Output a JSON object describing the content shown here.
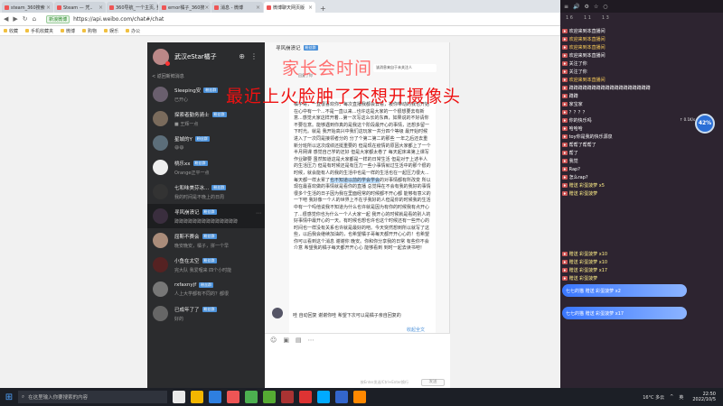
{
  "browser": {
    "tabs": [
      {
        "label": "steam_360搜索",
        "active": false
      },
      {
        "label": "Steam — 凭..",
        "active": false
      },
      {
        "label": "360导航_一个主页, 整个世界",
        "active": false
      },
      {
        "label": "ernor橘子_360搜",
        "active": false
      },
      {
        "label": "消息 - 微博",
        "active": false
      },
      {
        "label": "微博聊天网页版",
        "active": true
      }
    ],
    "new_tab": "+",
    "secure_label": "新浪微博",
    "url": "https://api.weibo.com/chat#/chat",
    "bookmarks": [
      "收藏",
      "手机收藏夹",
      "微博",
      "购物",
      "娱乐",
      "办公"
    ]
  },
  "sidebar": {
    "my_name": "武汉eStar橘子",
    "back_label": "< 返回新鲜消息",
    "conversations": [
      {
        "name": "Sleeping安",
        "badge": "粉丝群",
        "preview": "已开心",
        "color": "#6a5f6e",
        "active": false
      },
      {
        "name": "探索者勤务骑士",
        "badge": "粉丝群",
        "preview": "■ 王辉一点",
        "color": "#7a6b5c",
        "active": false
      },
      {
        "name": "星城的Y",
        "badge": "粉丝群",
        "preview": "😄😄",
        "color": "#5c6e7a",
        "active": false
      },
      {
        "name": "桃乐xx",
        "badge": "粉丝群",
        "preview": "Orange正平一点",
        "color": "#eee",
        "active": false
      },
      {
        "name": "七和味美芬冰...",
        "badge": "粉丝群",
        "preview": "我的时间是不晚上的日周",
        "color": "#333",
        "active": false
      },
      {
        "name": "寻风崩溃记",
        "badge": "粉丝群",
        "preview": "蹲蹲蹲蹲蹲蹲蹲蹲蹲蹲蹲蹲蹲蹲",
        "color": "#3a2e3e",
        "active": true
      },
      {
        "name": "屈斯不赛会",
        "badge": "粉丝群",
        "preview": "晚安晚安，橘子，拼一个早",
        "color": "#aa8c7a",
        "active": false
      },
      {
        "name": "小鱼在太空",
        "badge": "粉丝群",
        "preview": "完大队 我爱哩来 四个小时能",
        "color": "#552222",
        "active": false
      },
      {
        "name": "rxfaxnyjf",
        "badge": "粉丝群",
        "preview": "人上大学都有不同的？都很",
        "color": "#777",
        "active": false
      },
      {
        "name": "已成年了了",
        "badge": "粉丝群",
        "preview": "好的",
        "color": "#666",
        "active": false
      }
    ]
  },
  "chat": {
    "title": "寻风崩溃记",
    "badge": "粉丝群",
    "msg_top": "该消息来自于未关注人",
    "reply_tag": "回复了你",
    "long_msg_before": "橘子哥，一直很喜欢你，每次直播我都会去看，被你带动的我也开始在心中有一个...不是一直以来...也许这是大家的一个很想要去有新意...感觉大家这样开着...第一次写这么长的东西，如果说的不好请你不要在意。能够遇到你真的是我这个阶段最开心的事情，还想多留一下时光。就是 我开始高兴中我们这玩家一共分四个等级 最开始时候进入了一次同是接领者分的 分了个第二第二的那些 一年之后还去重新分班所以这次成绩还挺重要的 但是现在疫情的原因大家都上了一个半月网课 感觉自己学的还好 但是大家都太卷了 每天起床来第上课写作业聊要 虽然知道这是大家都是一样的日常生活 但是对于上述半人的生活压力 但是有时候还是有压力一些小事情就过生活中的那个很的时候，就会能有人的我的生活中也是一样的生活也在一起压力很大...每天都一样太累了",
    "long_msg_highlight": "也不知道以前的学会学会",
    "long_msg_after": "的对事情都有所改变 所以现在最喜欢做的事情就是看你的直播 总觉得在不会有我的我好的事情 很多个生活的日子因为我在里面经常的时候都不开心都 能够有意义的一下吧 我好像一个人的世界上不在乎我好的人但是你的时候我的生活中有一个吗他说我不知道为什么也许就是因为有你的时候我有点开心了...很感觉你也为什么一个人大家一起 我开心的时候就是看的别人的好事情中最开心的一天。有时候也想也许也这个时候还有一些开心的时间也一样没有关系也许就是最好的吧。今天突然想到所以就写了这些，以后我会继续加油的，也希望橘子哥每天都开开心心的！也希望你可以看到这个消息 谢谢你 晚安。你和你分享我的日常 有些你不会介意 希望我的橘子每天都开开心心 能够看到 到时一起去读书吧！",
    "read_tag": "收起全文",
    "auto_reply": "哇 自动回复 谢谢你哇 希望下次可以是橘子亲自回复的",
    "send_hint": "按Enter发送/Ctrl+Enter换行",
    "send_btn": "发送"
  },
  "overlay": {
    "line1": "家长会时间",
    "line2": "最近上火脸肿了不想开摄像头"
  },
  "right_panel": {
    "top_icons": [
      "≡",
      "🔊",
      "⚙",
      "☆",
      "○"
    ],
    "stats": [
      "1 6",
      "1 1",
      "1 3"
    ],
    "danmaku": [
      {
        "type": "chat",
        "user": "",
        "msg": "欢迎来到本直播间"
      },
      {
        "type": "join",
        "user": "",
        "msg": "欢迎来到本直播间"
      },
      {
        "type": "join",
        "user": "",
        "msg": "欢迎来到本直播间"
      },
      {
        "type": "chat",
        "user": "",
        "msg": "欢迎来到本直播间"
      },
      {
        "type": "chat",
        "user": "",
        "msg": "关注了你"
      },
      {
        "type": "chat",
        "user": "",
        "msg": "关注了你"
      },
      {
        "type": "join",
        "user": "",
        "msg": "欢迎来到本直播间"
      },
      {
        "type": "chat",
        "user": "",
        "msg": "蹲蹲蹲蹲蹲蹲蹲蹲蹲蹲蹲蹲蹲蹲蹲蹲蹲蹲"
      },
      {
        "type": "chat",
        "user": "",
        "msg": "蹲蹲"
      },
      {
        "type": "chat",
        "user": "",
        "msg": "家宝家"
      },
      {
        "type": "chat",
        "user": "",
        "msg": "？？？？"
      },
      {
        "type": "chat",
        "user": "",
        "msg": "你的快乐吗"
      },
      {
        "type": "chat",
        "user": "",
        "msg": "哈哈哈"
      },
      {
        "type": "chat",
        "user": "",
        "msg": "toy你是我的快乐源泉"
      },
      {
        "type": "chat",
        "user": "",
        "msg": "帮帮了帮帮了"
      },
      {
        "type": "chat",
        "user": "",
        "msg": "帮了"
      },
      {
        "type": "chat",
        "user": "",
        "msg": "我觉"
      },
      {
        "type": "chat",
        "user": "",
        "msg": "Rap?"
      },
      {
        "type": "chat",
        "user": "",
        "msg": "怎么rap?"
      },
      {
        "type": "gift",
        "user": "",
        "msg": "赠送 彩蛋菠萝 x5"
      },
      {
        "type": "gift",
        "user": "",
        "msg": "赠送 彩蛋菠萝"
      }
    ],
    "gift_card_1": "七七的猫  赠送 彩蛋菠萝 x2",
    "gift_card_2": "七七的猫  赠送 彩蛋菠萝 x17",
    "gift_tail": [
      {
        "type": "gift",
        "user": "",
        "msg": "赠送 彩蛋菠萝 x10"
      },
      {
        "type": "gift",
        "user": "",
        "msg": "赠送 彩蛋菠萝 x10"
      },
      {
        "type": "gift",
        "user": "",
        "msg": "赠送 彩蛋菠萝 x17"
      },
      {
        "type": "gift",
        "user": "",
        "msg": "赠送 彩蛋菠萝"
      }
    ],
    "battery": "42",
    "bat_stat": "↑ 0.1K/s\n↓ 3.4K/s"
  },
  "taskbar": {
    "search_placeholder": "在这里输入你要搜索的内容",
    "apps": [
      "#e9e9e9",
      "#f3b600",
      "#2e7fe0",
      "#e55",
      "#4caf50",
      "#5a3",
      "#a33",
      "#d33",
      "#0af",
      "#36c",
      "#f80"
    ],
    "tray": [
      "16°C 多云",
      "^",
      "英"
    ],
    "time": "22:50",
    "date": "2022/10/5"
  },
  "colors": {
    "overlay_1": "#ff6f6f",
    "overlay_2": "#ee1111",
    "sidebar_bg": "#2b2c2e",
    "gift_gradient": "#3a77ff"
  }
}
